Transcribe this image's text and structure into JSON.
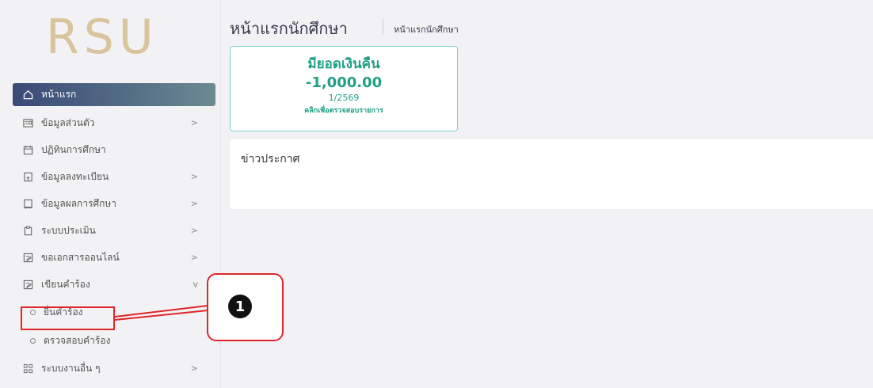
{
  "logo": {
    "text": "RSU"
  },
  "header": {
    "title": "หน้าแรกนักศึกษา",
    "breadcrumb": "หน้าแรกนักศึกษา"
  },
  "refund_card": {
    "heading": "มียอดเงินคืน",
    "amount": "-1,000.00",
    "term": "1/2569",
    "link": "คลิกเพื่อตรวจสอบรายการ"
  },
  "news": {
    "title": "ข่าวประกาศ"
  },
  "sidebar": {
    "items": [
      {
        "label": "หน้าแรก",
        "icon": "home-icon"
      },
      {
        "label": "ข้อมูลส่วนตัว",
        "icon": "id-card-icon",
        "chevron": ">"
      },
      {
        "label": "ปฏิทินการศึกษา",
        "icon": "calendar-icon"
      },
      {
        "label": "ข้อมูลลงทะเบียน",
        "icon": "register-icon",
        "chevron": ">"
      },
      {
        "label": "ข้อมูลผลการศึกษา",
        "icon": "book-icon",
        "chevron": ">"
      },
      {
        "label": "ระบบประเมิน",
        "icon": "clipboard-icon",
        "chevron": ">"
      },
      {
        "label": "ขอเอกสารออนไลน์",
        "icon": "edit-doc-icon",
        "chevron": ">"
      },
      {
        "label": "เขียนคำร้อง",
        "icon": "edit-doc-icon",
        "chevron": "v"
      },
      {
        "label": "ยื่นคำร้อง"
      },
      {
        "label": "ตรวจสอบคำร้อง"
      },
      {
        "label": "ระบบงานอื่น ๆ",
        "icon": "grid-icon",
        "chevron": ">"
      }
    ]
  },
  "callout": {
    "number": "1"
  },
  "colors": {
    "accent": "#1fa085",
    "highlight": "#e0252c",
    "active_menu": "#3a4a78"
  }
}
